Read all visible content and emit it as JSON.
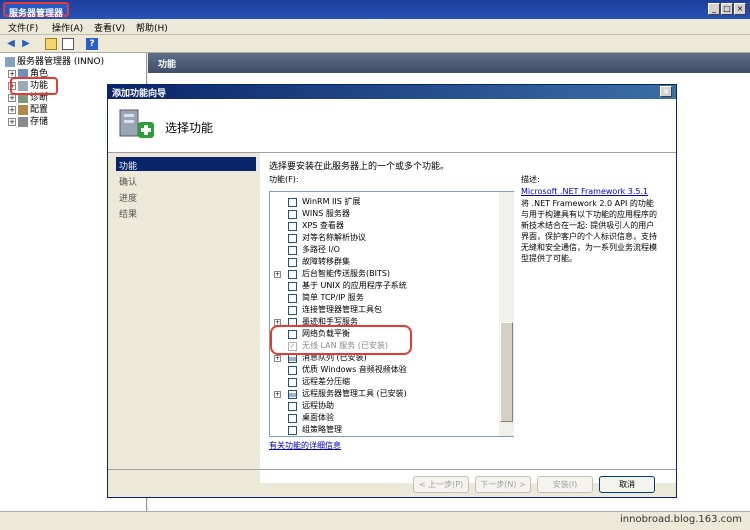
{
  "app": {
    "title": "服务器管理器"
  },
  "menu": [
    "文件(F)",
    "操作(A)",
    "查看(V)",
    "帮助(H)"
  ],
  "tree": {
    "root": "服务器管理器 (INNO)",
    "items": [
      "角色",
      "功能",
      "诊断",
      "配置",
      "存储"
    ]
  },
  "main": {
    "header": "功能"
  },
  "dialog": {
    "title": "添加功能向导",
    "heading": "选择功能",
    "nav": [
      "功能",
      "确认",
      "进度",
      "结果"
    ],
    "instruction": "选择要安装在此服务器上的一个或多个功能。",
    "features_label": "功能(F):",
    "features": [
      {
        "label": "WinRM IIS 扩展",
        "expand": false,
        "state": "unchecked"
      },
      {
        "label": "WINS 服务器",
        "expand": false,
        "state": "unchecked"
      },
      {
        "label": "XPS 查看器",
        "expand": false,
        "state": "unchecked"
      },
      {
        "label": "对等名称解析协议",
        "expand": false,
        "state": "unchecked"
      },
      {
        "label": "多路径 I/O",
        "expand": false,
        "state": "unchecked"
      },
      {
        "label": "故障转移群集",
        "expand": false,
        "state": "unchecked"
      },
      {
        "label": "后台智能传送服务(BITS)",
        "expand": true,
        "state": "unchecked"
      },
      {
        "label": "基于 UNIX 的应用程序子系统",
        "expand": false,
        "state": "unchecked"
      },
      {
        "label": "简单 TCP/IP 服务",
        "expand": false,
        "state": "unchecked"
      },
      {
        "label": "连接管理器管理工具包",
        "expand": false,
        "state": "unchecked"
      },
      {
        "label": "墨迹和手写服务",
        "expand": true,
        "state": "unchecked"
      },
      {
        "label": "网络负载平衡",
        "expand": false,
        "state": "unchecked"
      },
      {
        "label": "无线 LAN 服务  (已安装)",
        "expand": false,
        "state": "checked-disabled"
      },
      {
        "label": "消息队列  (已安装)",
        "expand": true,
        "state": "partial"
      },
      {
        "label": "优质 Windows 音频视频体验",
        "expand": false,
        "state": "unchecked"
      },
      {
        "label": "远程差分压缩",
        "expand": false,
        "state": "unchecked"
      },
      {
        "label": "远程服务器管理工具  (已安装)",
        "expand": true,
        "state": "partial"
      },
      {
        "label": "远程协助",
        "expand": false,
        "state": "unchecked"
      },
      {
        "label": "桌面体验",
        "expand": false,
        "state": "unchecked"
      },
      {
        "label": "组策略管理",
        "expand": false,
        "state": "unchecked"
      }
    ],
    "more_info_link": "有关功能的详细信息",
    "description_label": "描述:",
    "description_link": "Microsoft .NET Framework 3.5.1",
    "description_text": "将 .NET Framework 2.0 API 的功能与用于构建具有以下功能的应用程序的新技术结合在一起: 提供吸引人的用户界面，保护客户的个人标识信息，支持无缝和安全通信，为一系列业务流程模型提供了可能。",
    "buttons": {
      "prev": "< 上一步(P)",
      "next": "下一步(N) >",
      "install": "安装(I)",
      "cancel": "取消"
    }
  },
  "status": {
    "watermark": "innobroad.blog.163.com"
  }
}
